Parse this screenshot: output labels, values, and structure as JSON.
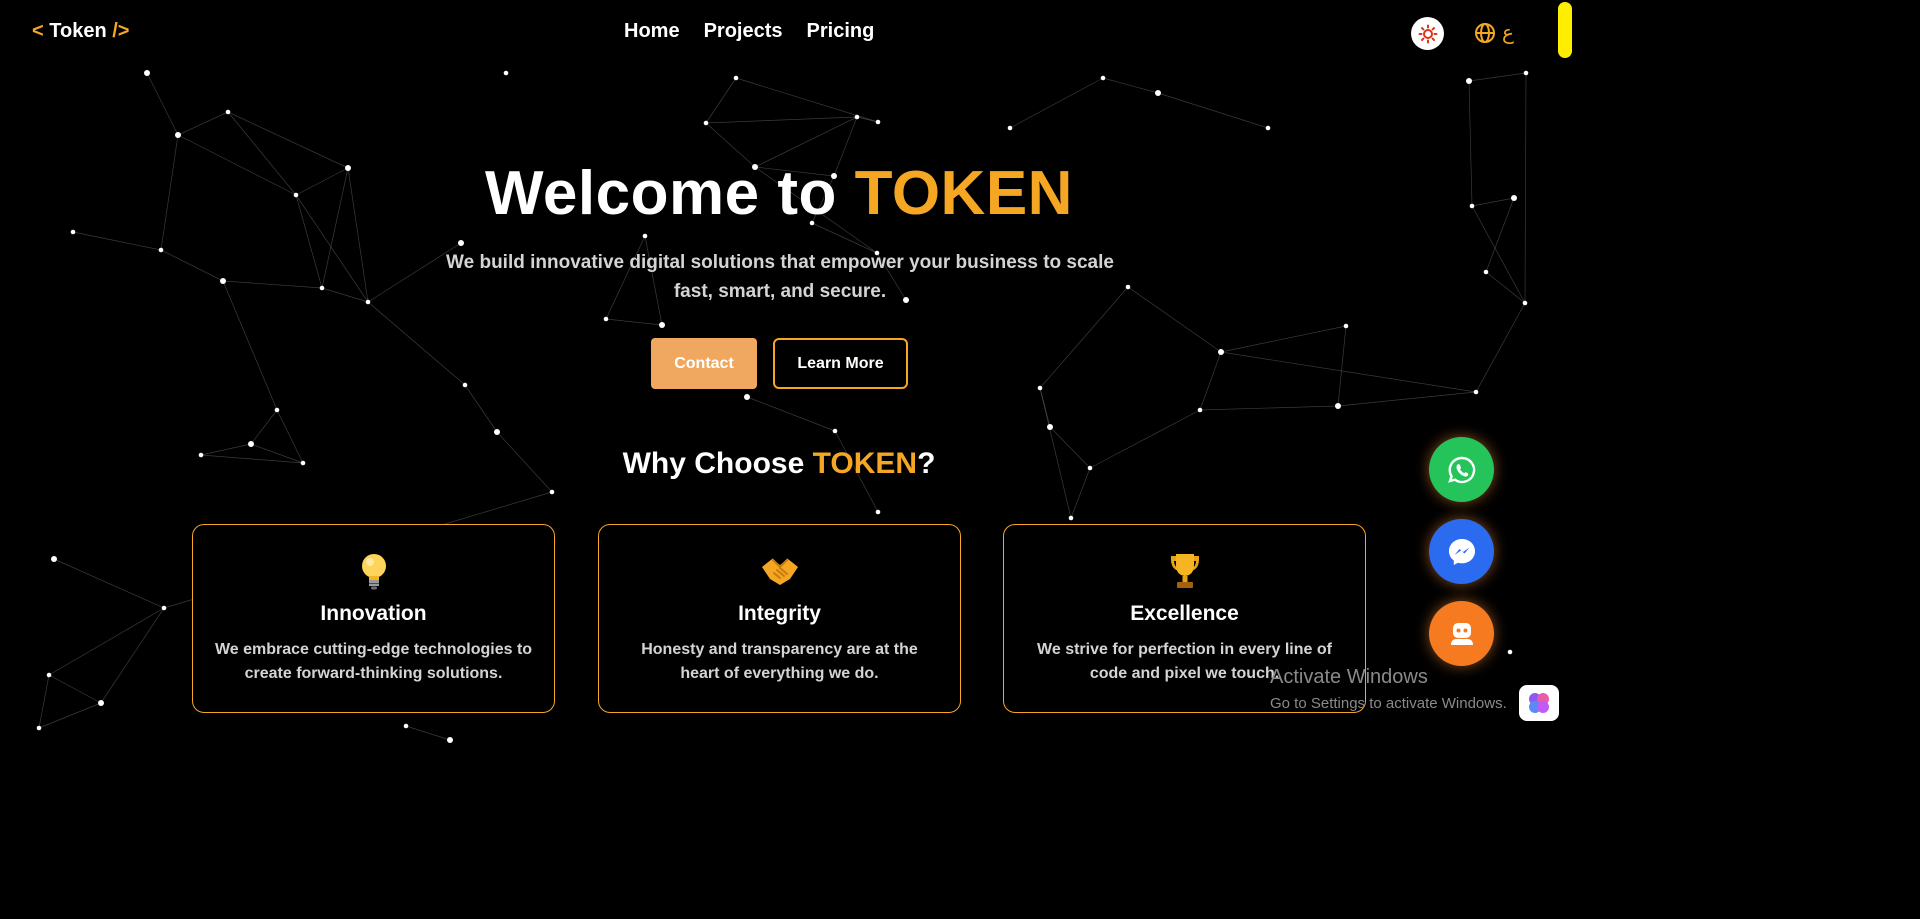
{
  "nav": {
    "logo": {
      "open": "<",
      "name": "Token",
      "close": "/>"
    },
    "links": [
      "Home",
      "Projects",
      "Pricing"
    ],
    "lang_label": "ع",
    "theme_icon": "sun-icon",
    "lang_icon": "globe-icon"
  },
  "hero": {
    "title_prefix": "Welcome to",
    "title_accent": "TOKEN",
    "subtitle": "We build innovative digital solutions that empower your business to scale fast, smart, and secure.",
    "contact_label": "Contact",
    "learn_label": "Learn More"
  },
  "why": {
    "title_prefix": "Why Choose ",
    "title_accent": "TOKEN",
    "title_suffix": "?"
  },
  "cards": [
    {
      "icon": "lightbulb-icon",
      "title": "Innovation",
      "text": "We embrace cutting-edge technologies to create forward-thinking solutions."
    },
    {
      "icon": "handshake-icon",
      "title": "Integrity",
      "text": "Honesty and transparency are at the heart of everything we do."
    },
    {
      "icon": "trophy-icon",
      "title": "Excellence",
      "text": "We strive for perfection in every line of code and pixel we touch."
    }
  ],
  "floating": [
    "whatsapp-icon",
    "messenger-icon",
    "chatbot-icon"
  ],
  "watermark": {
    "line1": "Activate Windows",
    "line2": "Go to Settings to activate Windows."
  },
  "colors": {
    "background": "#000000",
    "accent": "#f5a623",
    "contact_button": "#f0a860",
    "whatsapp": "#25c45a",
    "messenger": "#2a6bf0",
    "bot": "#f57a20"
  }
}
